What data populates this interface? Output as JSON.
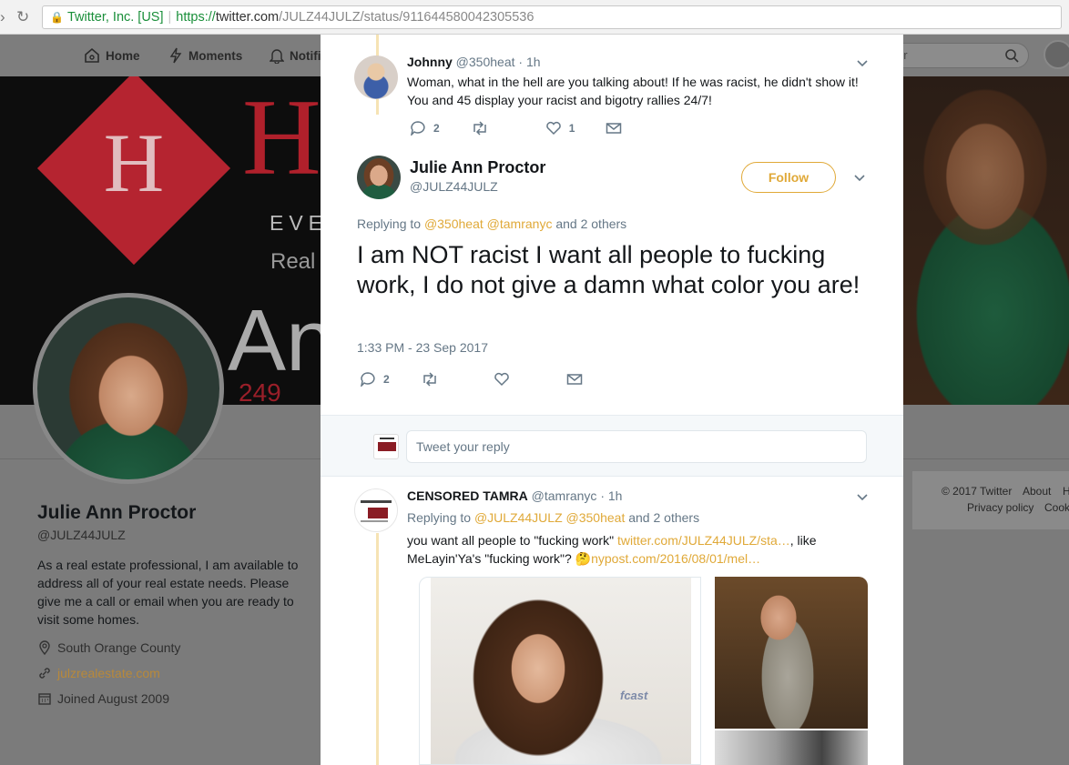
{
  "browser": {
    "secure_label": "Twitter, Inc. [US]",
    "url_proto": "https://",
    "url_host": "twitter.com",
    "url_path": "/JULZ44JULZ/status/911644580042305536"
  },
  "nav": {
    "home": "Home",
    "moments": "Moments",
    "notifications": "Notifi",
    "search_placeholder": "er"
  },
  "banner": {
    "ho": "HO",
    "eve": "EVE",
    "real": "Real",
    "an": "An",
    "num": "249"
  },
  "profile": {
    "name": "Julie Ann Proctor",
    "handle": "@JULZ44JULZ",
    "bio": "As a real estate professional, I am available to address all of your real estate needs. Please give me a call or email when you are ready to visit some homes.",
    "location": "South Orange County",
    "website": "julzrealestate.com",
    "joined": "Joined August 2009"
  },
  "footer": {
    "copyright": "© 2017 Twitter",
    "about": "About",
    "h": "H",
    "privacy": "Privacy policy",
    "cookies": "Cook"
  },
  "reply1": {
    "name": "Johnny",
    "handle": "@350heat",
    "time": "· 1h",
    "text": "Woman, what in the hell are you talking about! If he was racist, he didn't show it! You and 45 display your racist and bigotry rallies 24/7!",
    "replies": "2",
    "likes": "1"
  },
  "main_tweet": {
    "name": "Julie Ann Proctor",
    "handle": "@JULZ44JULZ",
    "follow_label": "Follow",
    "replying_prefix": "Replying to",
    "replying_user1": "@350heat",
    "replying_user2": "@tamranyc",
    "replying_suffix": "and 2 others",
    "text": "I am NOT racist I want all people to fucking work, I do not give a damn what color you are!",
    "timestamp": "1:33 PM - 23 Sep 2017",
    "replies": "2"
  },
  "reply_box": {
    "placeholder": "Tweet your reply"
  },
  "reply2": {
    "name": "CENSORED TAMRA",
    "handle": "@tamranyc",
    "time": "· 1h",
    "replying_prefix": "Replying to",
    "replying_user1": "@JULZ44JULZ",
    "replying_user2": "@350heat",
    "replying_suffix": "and 2 others",
    "text_part1": "you want all people to \"fucking work\"",
    "link1": "twitter.com/JULZ44JULZ/sta…",
    "text_part2": ", like MeLayin'Ya's \"fucking work\"?",
    "emoji": "🤔",
    "link2": "nypost.com/2016/08/01/mel…",
    "media_logo": "fcast"
  },
  "colors": {
    "accent": "#e0a938",
    "overlay_bg": "#7b7b7b",
    "banner_red": "#b0202b"
  }
}
